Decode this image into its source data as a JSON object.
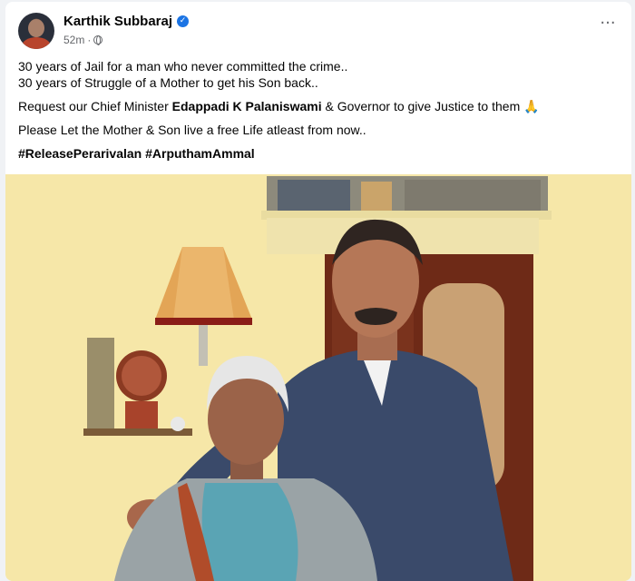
{
  "post": {
    "author": "Karthik Subbaraj",
    "time": "52m",
    "more_label": "···",
    "line1": "30 years of Jail for a man who never committed the crime..",
    "line2": "30 years of Struggle of a Mother to get his Son back..",
    "line3_prefix": "Request our Chief Minister ",
    "line3_bold": "Edappadi K Palaniswami",
    "line3_suffix": " & Governor to give Justice to them 🙏",
    "line4": "Please Let the Mother & Son live a free Life atleast from now..",
    "hashtag1": "#ReleasePerarivalan",
    "hashtag2": "#ArputhamAmmal"
  },
  "icons": {
    "verified": "verified-badge-icon",
    "privacy": "globe-icon",
    "more": "more-options-icon"
  },
  "colors": {
    "link": "#1b74e4",
    "secondary_text": "#65676b",
    "wall": "#f7e9ad"
  }
}
